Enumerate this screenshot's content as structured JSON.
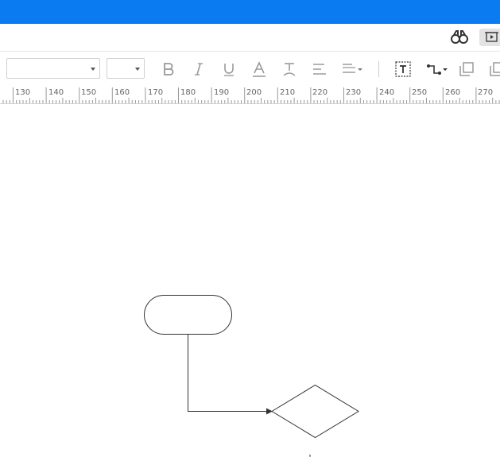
{
  "toolbar": {
    "font_family_value": "",
    "font_size_value": "",
    "buttons": [
      "bold",
      "italic",
      "underline",
      "font-color",
      "text-background",
      "align",
      "line-spacing",
      "text-box",
      "connector",
      "arrange-front",
      "arrange-back"
    ]
  },
  "ruler": {
    "labels": [
      "130",
      "140",
      "150",
      "160",
      "170",
      "180",
      "190",
      "200",
      "210",
      "220",
      "230",
      "240",
      "250",
      "260",
      "270"
    ]
  },
  "colors": {
    "accent": "#0a7bf0"
  },
  "canvas": {
    "shapes": [
      {
        "kind": "terminator"
      },
      {
        "kind": "decision"
      }
    ]
  }
}
